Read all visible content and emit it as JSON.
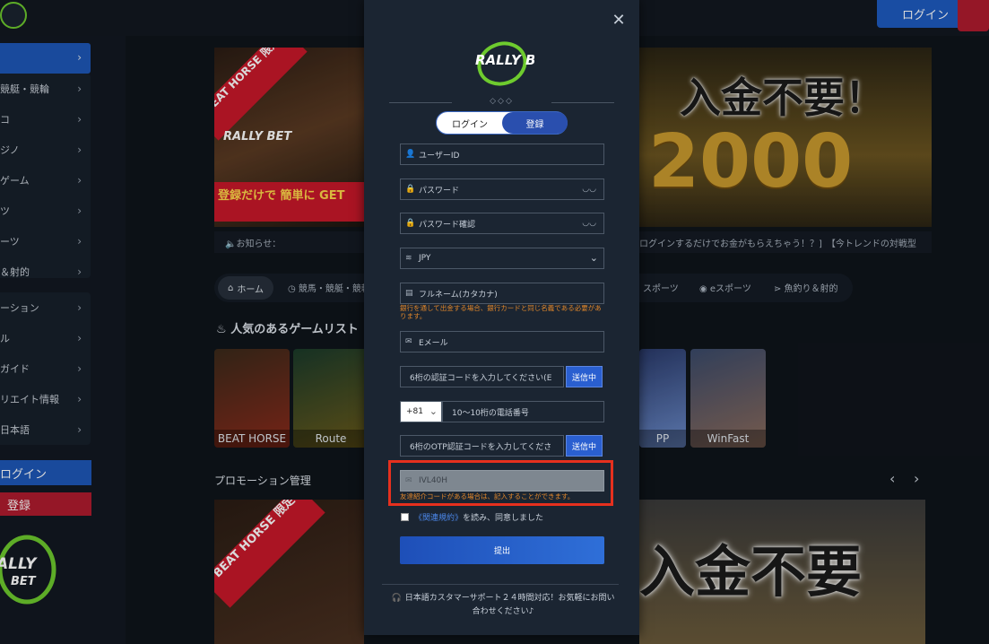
{
  "header": {
    "login_label": "ログイン"
  },
  "sidebar": {
    "items": [
      {
        "label": ""
      },
      {
        "label": "競艇・競輪"
      },
      {
        "label": "コ"
      },
      {
        "label": "ジノ"
      },
      {
        "label": "ゲーム"
      },
      {
        "label": "ツ"
      },
      {
        "label": "ーツ"
      },
      {
        "label": "＆射的"
      },
      {
        "label": "ーション"
      },
      {
        "label": "ル"
      },
      {
        "label": "ガイド"
      },
      {
        "label": "リエイト情報"
      },
      {
        "label": "日本語"
      }
    ],
    "login_label": "ログイン",
    "register_label": "登録",
    "logo_text": "RALLY BET"
  },
  "banners": {
    "left": {
      "ribbon": "BEAT HORSE 限定",
      "brand": "RALLY BET",
      "tagline": "登録だけで 簡単に GET"
    },
    "right": {
      "headline": "入金不要！",
      "amount": "2000"
    }
  },
  "notice": {
    "label": "🔈お知らせ：",
    "ticker": "ログインするだけでお金がもらえちゃう！？]　【今トレンドの対戦型"
  },
  "categories": {
    "home": "ホーム",
    "horse": "競馬・競艇・競輪",
    "sports": "スポーツ",
    "esports": "eスポーツ",
    "fishing": "魚釣り＆射的"
  },
  "popular": {
    "title": "人気のあるゲームリスト",
    "games": [
      {
        "label": "BEAT HORSE"
      },
      {
        "label": "Route"
      },
      {
        "label": "PP"
      },
      {
        "label": "WinFast"
      }
    ]
  },
  "promo": {
    "title": "プロモーション管理",
    "left_ribbon": "BEAT HORSE 限定",
    "right_headline": "入金不要"
  },
  "modal": {
    "logo_text": "RALLY BET",
    "deco": "◇◇◇",
    "tab_login": "ログイン",
    "tab_register": "登録",
    "fields": {
      "user_id": "ユーザーID",
      "password": "パスワード",
      "password_confirm": "パスワード確認",
      "currency": "JPY",
      "fullname": "フルネーム(カタカナ)",
      "fullname_hint": "銀行を通して出金する場合、銀行カードと同じ名義である必要があります。",
      "email": "Eメール",
      "email_code": "6桁の認証コードを入力してください(E",
      "email_code_button": "送信中",
      "country_code": "+81",
      "phone": "10～10桁の電話番号",
      "otp_code": "6桁のOTP認証コードを入力してくださ",
      "otp_button": "送信中",
      "referral_code": "IVL40H",
      "referral_hint": "友達紹介コードがある場合は、記入することができます。"
    },
    "agree_link": "《関連規約》",
    "agree_text": "を読み、同意しました",
    "submit_label": "提出",
    "support": "日本語カスタマーサポート２４時間対応！お気軽にお問い合わせください♪"
  }
}
